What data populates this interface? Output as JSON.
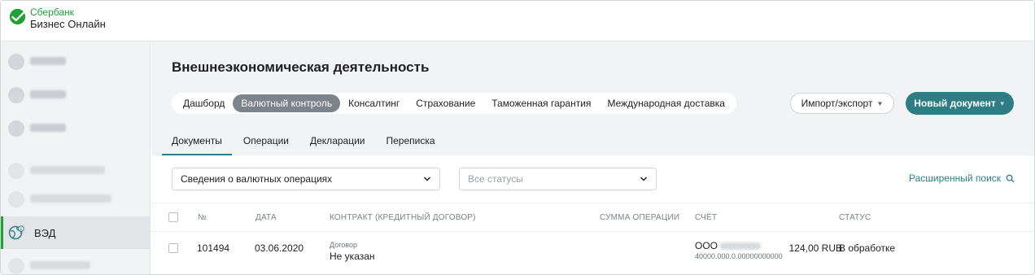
{
  "header": {
    "brand_line1": "Сбербанк",
    "brand_line2": "Бизнес Онлайн",
    "brand_color": "#21a038"
  },
  "sidebar": {
    "items": [
      {
        "label": "",
        "icon": "create-icon",
        "blurred": true
      },
      {
        "label": "",
        "icon": "payment-icon",
        "blurred": true
      },
      {
        "label": "",
        "icon": "transfer-icon",
        "blurred": true
      },
      {
        "label": "",
        "icon": "deposit-icon",
        "blurred": true
      },
      {
        "label": "",
        "icon": "documents-icon",
        "blurred": true
      },
      {
        "label": "ВЭД",
        "icon": "globe-currency-icon",
        "active": true
      },
      {
        "label": "",
        "icon": "other-icon",
        "blurred": true
      }
    ]
  },
  "main": {
    "title": "Внешнеэкономическая деятельность",
    "sections": [
      "Дашборд",
      "Валютный контроль",
      "Консалтинг",
      "Страхование",
      "Таможенная гарантия",
      "Международная доставка"
    ],
    "selected_section": "Валютный контроль",
    "import_export_label": "Импорт/экспорт",
    "new_document_label": "Новый документ",
    "accent_color": "#2f7d84",
    "tabs": [
      "Документы",
      "Операции",
      "Декларации",
      "Переписка"
    ],
    "selected_tab": "Документы"
  },
  "filters": {
    "type_value": "Сведения о валютных операциях",
    "status_placeholder": "Все статусы",
    "advanced_search": "Расширенный поиск"
  },
  "table": {
    "headers": {
      "number": "№",
      "date": "ДАТА",
      "contract": "КОНТРАКТ (КРЕДИТНЫЙ ДОГОВОР)",
      "amount": "СУММА ОПЕРАЦИИ",
      "account": "СЧЁТ",
      "status": "СТАТУС"
    },
    "rows": [
      {
        "number": "101494",
        "date": "03.06.2020",
        "contract_caption": "Договор",
        "contract_value": "Не указан",
        "amount": "124,00 RUB",
        "account_name": "ООО",
        "account_number": "40000.000.0.00000000000",
        "status": "В обработке"
      }
    ]
  }
}
